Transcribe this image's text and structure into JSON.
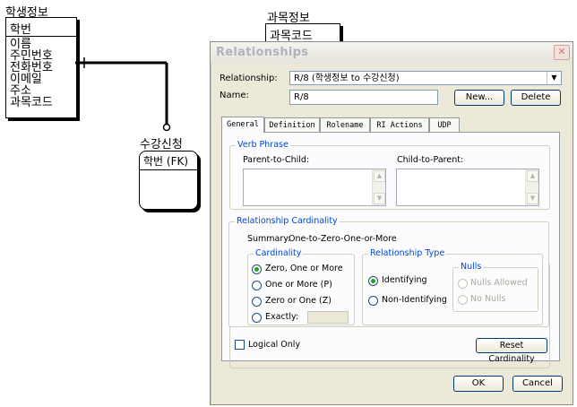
{
  "diagram": {
    "entity_student": {
      "name": "학생정보",
      "key": "학번",
      "attributes": [
        "이름",
        "주민번호",
        "전화번호",
        "이메일",
        "주소",
        "과목코드"
      ]
    },
    "entity_course": {
      "name": "과목정보",
      "key": "과목코드"
    },
    "entity_enroll": {
      "name": "수강신청",
      "key": "학번 (FK)"
    }
  },
  "dialog": {
    "title": "Relationships",
    "close_glyph": "✕",
    "relationship_label": "Relationship:",
    "relationship_value": "R/8 (학생정보 to 수강신청)",
    "name_label": "Name:",
    "name_value": "R/8",
    "new_button": "New...",
    "delete_button": "Delete",
    "tabs": [
      "General",
      "Definition",
      "Rolename",
      "RI Actions",
      "UDP"
    ],
    "verb_phrase": {
      "title": "Verb Phrase",
      "parent_to_child": "Parent-to-Child:",
      "child_to_parent": "Child-to-Parent:"
    },
    "cardinality_group": {
      "title": "Relationship Cardinality",
      "summary_label": "Summary:",
      "summary_value": "One-to-Zero-One-or-More",
      "cardinality_title": "Cardinality",
      "options": [
        "Zero, One or More",
        "One or More (P)",
        "Zero or One (Z)",
        "Exactly:"
      ],
      "selected": "Zero, One or More",
      "rel_type_title": "Relationship Type",
      "rel_types": [
        "Identifying",
        "Non-Identifying"
      ],
      "rel_type_selected": "Identifying",
      "nulls_title": "Nulls",
      "nulls_options": [
        "Nulls Allowed",
        "No Nulls"
      ]
    },
    "logical_only": "Logical Only",
    "reset_button": "Reset Cardinality",
    "ok_button": "OK",
    "cancel_button": "Cancel"
  },
  "colors": {
    "group_title": "#0046d5",
    "dialog_bg": "#ece9d8",
    "selected_radio": "#21a121"
  }
}
